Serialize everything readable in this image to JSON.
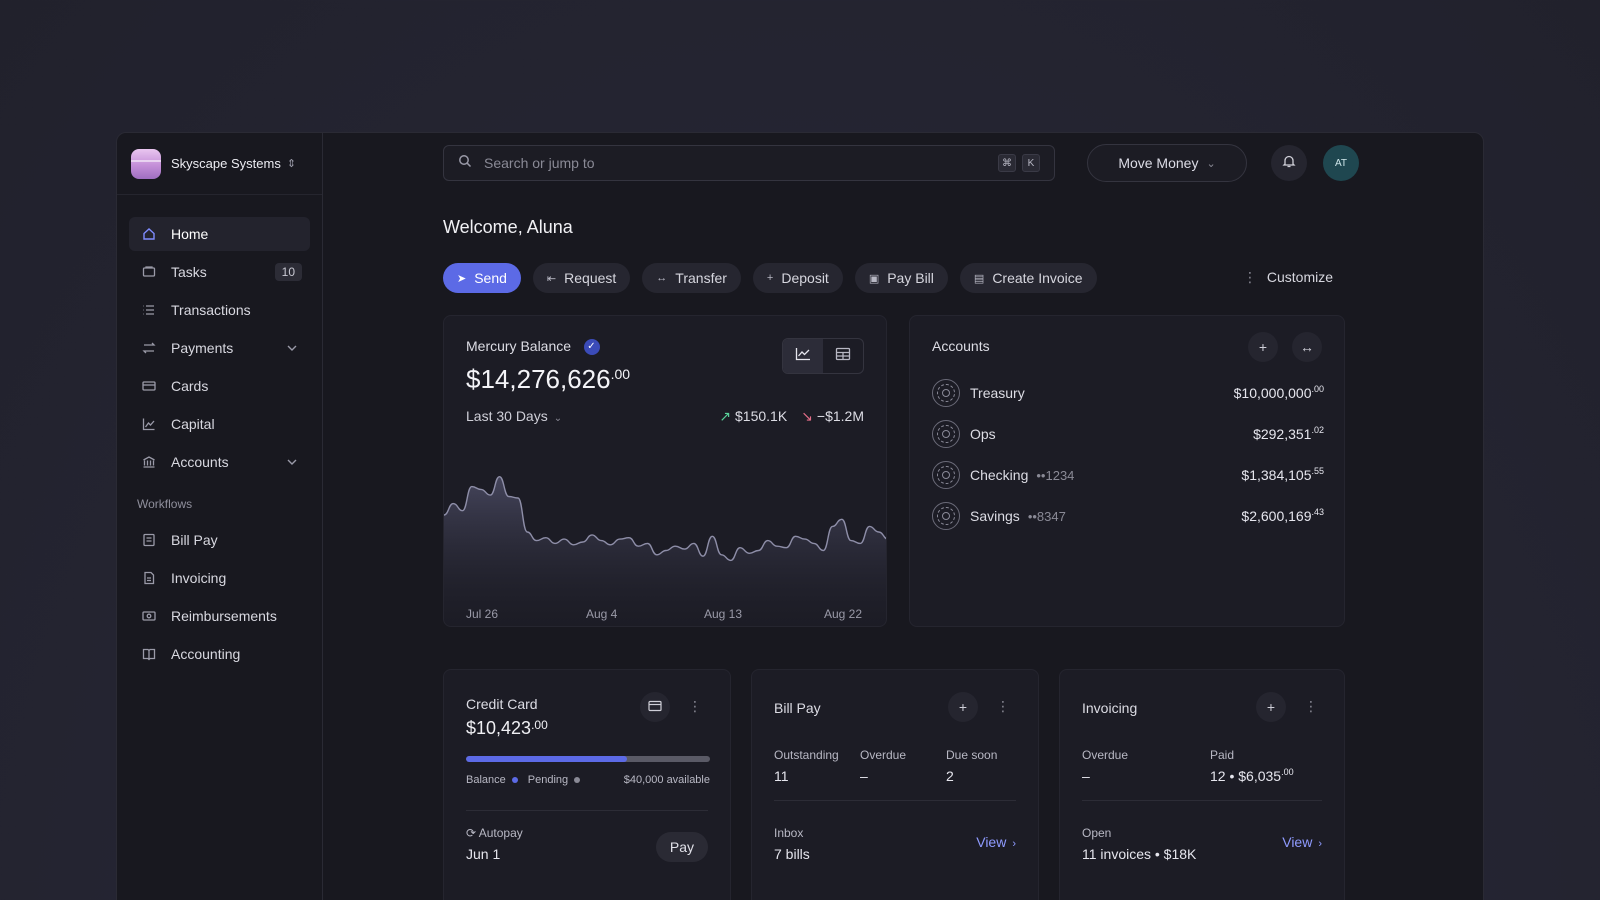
{
  "org": {
    "name": "Skyscape Systems"
  },
  "nav": {
    "items": [
      {
        "label": "Home",
        "icon": "home-icon",
        "active": true
      },
      {
        "label": "Tasks",
        "icon": "tasks-icon",
        "badge": "10"
      },
      {
        "label": "Transactions",
        "icon": "list-icon"
      },
      {
        "label": "Payments",
        "icon": "arrows-icon",
        "expandable": true
      },
      {
        "label": "Cards",
        "icon": "card-icon"
      },
      {
        "label": "Capital",
        "icon": "chart-icon"
      },
      {
        "label": "Accounts",
        "icon": "bank-icon",
        "expandable": true
      }
    ],
    "workflows_label": "Workflows",
    "workflows": [
      {
        "label": "Bill Pay",
        "icon": "bill-icon"
      },
      {
        "label": "Invoicing",
        "icon": "invoice-icon"
      },
      {
        "label": "Reimbursements",
        "icon": "reimburse-icon"
      },
      {
        "label": "Accounting",
        "icon": "book-icon"
      }
    ]
  },
  "topbar": {
    "search_placeholder": "Search or jump to",
    "shortcut_keys": [
      "⌘",
      "K"
    ],
    "move_money_label": "Move Money",
    "avatar_initials": "AT"
  },
  "welcome": "Welcome, Aluna",
  "actions": [
    {
      "label": "Send",
      "icon": "send-icon",
      "glyph": "➤",
      "primary": true
    },
    {
      "label": "Request",
      "icon": "request-icon",
      "glyph": "⇤"
    },
    {
      "label": "Transfer",
      "icon": "transfer-icon",
      "glyph": "↔"
    },
    {
      "label": "Deposit",
      "icon": "plus-icon",
      "glyph": "+"
    },
    {
      "label": "Pay Bill",
      "icon": "bill-icon",
      "glyph": "▣"
    },
    {
      "label": "Create Invoice",
      "icon": "invoice-icon",
      "glyph": "▤"
    }
  ],
  "customize_label": "Customize",
  "balance": {
    "title": "Mercury Balance",
    "amount": "$14,276,626",
    "cents": ".00",
    "range": "Last 30 Days",
    "money_in": "$150.1K",
    "money_out": "−$1.2M"
  },
  "chart_data": {
    "type": "area",
    "x": [
      "Jul 26",
      "Aug 4",
      "Aug 13",
      "Aug 22"
    ],
    "values": [
      50,
      58,
      53,
      70,
      68,
      64,
      77,
      63,
      62,
      38,
      32,
      34,
      30,
      33,
      29,
      31,
      36,
      32,
      29,
      33,
      34,
      28,
      30,
      22,
      25,
      28,
      26,
      30,
      21,
      35,
      22,
      18,
      27,
      23,
      25,
      32,
      28,
      27,
      35,
      33,
      30,
      25,
      42,
      47,
      32,
      30,
      42,
      38,
      33
    ]
  },
  "accounts": {
    "title": "Accounts",
    "rows": [
      {
        "name": "Treasury",
        "mask": "",
        "amount": "$10,000,000",
        "cents": ".00"
      },
      {
        "name": "Ops",
        "mask": "",
        "amount": "$292,351",
        "cents": ".02"
      },
      {
        "name": "Checking",
        "mask": "••1234",
        "amount": "$1,384,105",
        "cents": ".55"
      },
      {
        "name": "Savings",
        "mask": "••8347",
        "amount": "$2,600,169",
        "cents": ".43"
      }
    ]
  },
  "credit_card": {
    "title": "Credit Card",
    "amount": "$10,423",
    "cents": ".00",
    "progress_fraction": 0.66,
    "balance_label": "Balance",
    "pending_label": "Pending",
    "available": "$40,000 available",
    "autopay_label": "Autopay",
    "autopay_date": "Jun 1",
    "pay_label": "Pay",
    "colors": {
      "balance": "#5c6ae6",
      "pending": "#8a8a96"
    }
  },
  "bill_pay": {
    "title": "Bill Pay",
    "stats": [
      {
        "label": "Outstanding",
        "value": "11"
      },
      {
        "label": "Overdue",
        "value": "–"
      },
      {
        "label": "Due soon",
        "value": "2"
      }
    ],
    "inbox_label": "Inbox",
    "inbox_value": "7 bills",
    "view_label": "View"
  },
  "invoicing": {
    "title": "Invoicing",
    "stats": [
      {
        "label": "Overdue",
        "value": "–"
      },
      {
        "label": "Paid",
        "value": "12 • $6,035",
        "cents": ".00"
      }
    ],
    "open_label": "Open",
    "open_value": "11 invoices • $18K",
    "view_label": "View"
  }
}
